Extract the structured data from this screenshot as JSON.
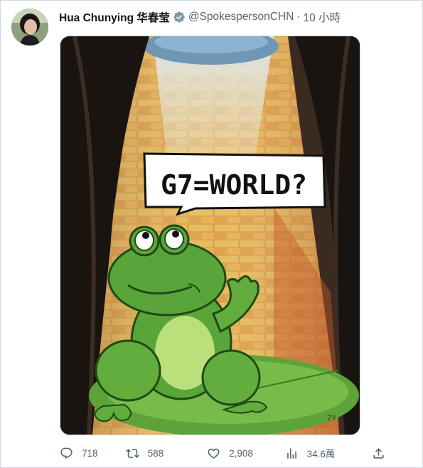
{
  "tweet": {
    "author_name": "Hua Chunying 华春莹",
    "handle": "@SpokespersonCHN",
    "separator": "·",
    "time": "10 小時",
    "image": {
      "speech_text": "G7=WORLD?",
      "signature": "ZY"
    },
    "stats": {
      "replies": "718",
      "retweets": "588",
      "likes": "2,908",
      "views": "34.6萬"
    }
  },
  "icons": {
    "verified": "verified-badge-icon",
    "reply": "reply-icon",
    "retweet": "retweet-icon",
    "like": "heart-icon",
    "views": "views-chart-icon",
    "share": "share-icon"
  },
  "colors": {
    "text_primary": "#0f1419",
    "text_secondary": "#536471",
    "border": "#cfd9de",
    "verified": "#829aab"
  }
}
